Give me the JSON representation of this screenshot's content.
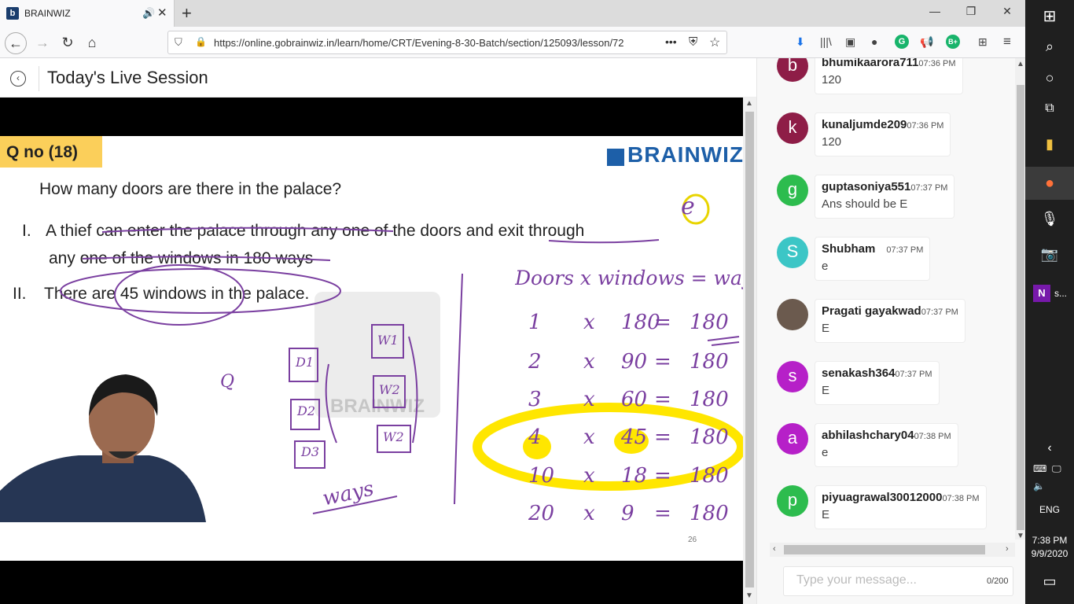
{
  "browser": {
    "tab_title": "BRAINWIZ",
    "tab_favicon": "b",
    "url": "https://online.gobrainwiz.in/learn/home/CRT/Evening-8-30-Batch/section/125093/lesson/72",
    "url_more": "•••"
  },
  "page": {
    "title": "Today's Live Session"
  },
  "slide": {
    "qno": "Q no (18)",
    "logo": "BRAINWIZ",
    "question": "How many doors are there in the palace?",
    "s1_num": "I.",
    "s1_line1": "A thief can enter the palace through any one of the doors and exit through",
    "s1_line2": "any one of the windows in 180 ways",
    "s2_num": "II.",
    "s2_text": "There are 45 windows in the palace.",
    "watermark": "BRAINWIZ",
    "page_num": "26",
    "hw": {
      "answer": "e",
      "header": "Doors x windows = ways",
      "rows": [
        [
          "1",
          "x",
          "180",
          "=",
          "180"
        ],
        [
          "2",
          "x",
          "90",
          "=",
          "180"
        ],
        [
          "3",
          "x",
          "60",
          "=",
          "180"
        ],
        [
          "4",
          "x",
          "45",
          "=",
          "180"
        ],
        [
          "10",
          "x",
          "18",
          "=",
          "180"
        ],
        [
          "20",
          "x",
          "9",
          "=",
          "180"
        ]
      ],
      "doors": [
        "D1",
        "D2",
        "D3"
      ],
      "windows": [
        "W1",
        "W2",
        "W2"
      ],
      "ways": "ways",
      "q": "Q"
    }
  },
  "chat": {
    "messages": [
      {
        "initial": "b",
        "user": "bhumikaarora711",
        "time": "07:36 PM",
        "text": "120",
        "color": "#8e1d47"
      },
      {
        "initial": "k",
        "user": "kunaljumde209",
        "time": "07:36 PM",
        "text": "120",
        "color": "#8e1d47"
      },
      {
        "initial": "g",
        "user": "guptasoniya551",
        "time": "07:37 PM",
        "text": "Ans should be E",
        "color": "#2dbc4e"
      },
      {
        "initial": "S",
        "user": "Shubham",
        "time": "07:37 PM",
        "text": "e",
        "color": "#3cc6c6"
      },
      {
        "initial": "",
        "user": "Pragati gayakwad",
        "time": "07:37 PM",
        "text": "E",
        "color": "#6b5a4e"
      },
      {
        "initial": "s",
        "user": "senakash364",
        "time": "07:37 PM",
        "text": "E",
        "color": "#b620c8"
      },
      {
        "initial": "a",
        "user": "abhilashchary04",
        "time": "07:38 PM",
        "text": "e",
        "color": "#b620c8"
      },
      {
        "initial": "p",
        "user": "piyuagrawal30012000",
        "time": "07:38 PM",
        "text": "E",
        "color": "#2dbc4e"
      }
    ],
    "input_placeholder": "Type your message...",
    "char_count": "0/200"
  },
  "taskbar": {
    "onenote_label": "s...",
    "lang": "ENG",
    "time": "7:38 PM",
    "date": "9/9/2020"
  }
}
